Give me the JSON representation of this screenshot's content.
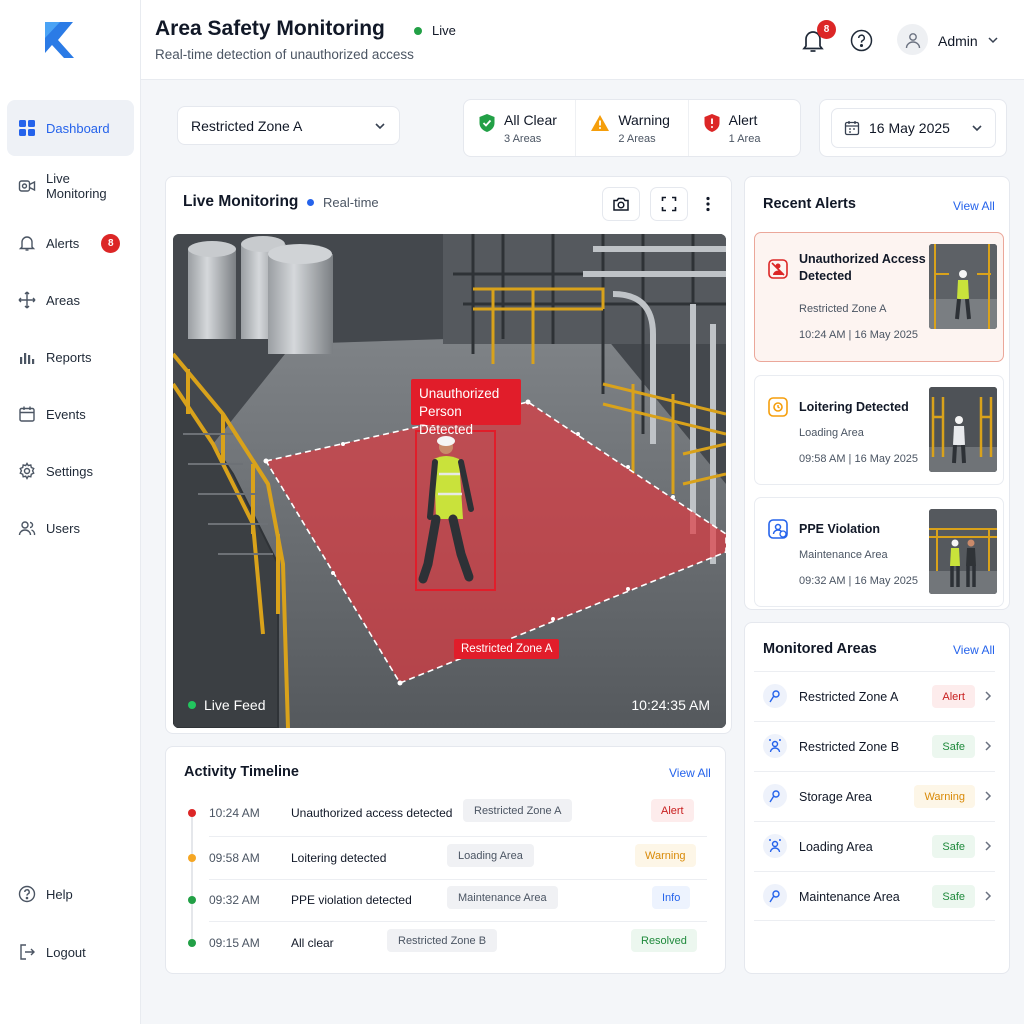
{
  "app": {
    "title": "Area Safety Monitoring",
    "subtitle": "Real-time detection of unauthorized access",
    "live_label": "Live"
  },
  "header": {
    "notification_count": "8",
    "user_name": "Admin"
  },
  "colors": {
    "primary": "#2563eb",
    "alert": "#dc2626",
    "warning": "#f59e0b",
    "safe": "#22a046"
  },
  "sidebar": {
    "items": [
      {
        "label": "Dashboard",
        "icon": "grid-icon",
        "active": true
      },
      {
        "label": "Live Monitoring",
        "icon": "camera-icon"
      },
      {
        "label": "Alerts",
        "icon": "bell-icon",
        "badge": "8"
      },
      {
        "label": "Areas",
        "icon": "areas-icon"
      },
      {
        "label": "Reports",
        "icon": "chart-icon"
      },
      {
        "label": "Events",
        "icon": "calendar-icon"
      },
      {
        "label": "Settings",
        "icon": "gear-icon"
      },
      {
        "label": "Users",
        "icon": "users-icon"
      }
    ],
    "help_label": "Help",
    "logout_label": "Logout"
  },
  "filters": {
    "zone": "Restricted Zone A",
    "date": "16 May 2025",
    "status": [
      {
        "label": "All Clear",
        "count": "3 Areas",
        "icon": "shield-check-icon"
      },
      {
        "label": "Warning",
        "count": "2 Areas",
        "icon": "warning-triangle-icon"
      },
      {
        "label": "Alert",
        "count": "1 Area",
        "icon": "shield-alert-icon"
      }
    ]
  },
  "live": {
    "title": "Live Monitoring",
    "realtime_label": "Real-time",
    "detection_label": "Unauthorized Person Detected",
    "zone_label": "Restricted Zone A",
    "feed_label": "Live Feed",
    "timestamp": "10:24:35 AM"
  },
  "timeline": {
    "title": "Activity Timeline",
    "view_all": "View All",
    "rows": [
      {
        "time": "10:24 AM",
        "event": "Unauthorized access detected",
        "zone": "Restricted Zone A",
        "status": "Alert"
      },
      {
        "time": "09:58 AM",
        "event": "Loitering detected",
        "zone": "Loading Area",
        "status": "Warning"
      },
      {
        "time": "09:32 AM",
        "event": "PPE violation detected",
        "zone": "Maintenance Area",
        "status": "Info"
      },
      {
        "time": "09:15 AM",
        "event": "All clear",
        "zone": "Restricted Zone B",
        "status": "Resolved"
      }
    ]
  },
  "alerts": {
    "title": "Recent Alerts",
    "view_all": "View All",
    "items": [
      {
        "title": "Unauthorized Access Detected",
        "location": "Restricted Zone A",
        "time": "10:24 AM | 16 May 2025"
      },
      {
        "title": "Loitering Detected",
        "location": "Loading Area",
        "time": "09:58 AM | 16 May 2025"
      },
      {
        "title": "PPE Violation",
        "location": "Maintenance Area",
        "time": "09:32 AM | 16 May 2025"
      }
    ]
  },
  "areas": {
    "title": "Monitored Areas",
    "view_all": "View All",
    "items": [
      {
        "name": "Restricted Zone A",
        "status": "Alert"
      },
      {
        "name": "Restricted Zone B",
        "status": "Safe"
      },
      {
        "name": "Storage Area",
        "status": "Warning"
      },
      {
        "name": "Loading Area",
        "status": "Safe"
      },
      {
        "name": "Maintenance Area",
        "status": "Safe"
      }
    ]
  }
}
